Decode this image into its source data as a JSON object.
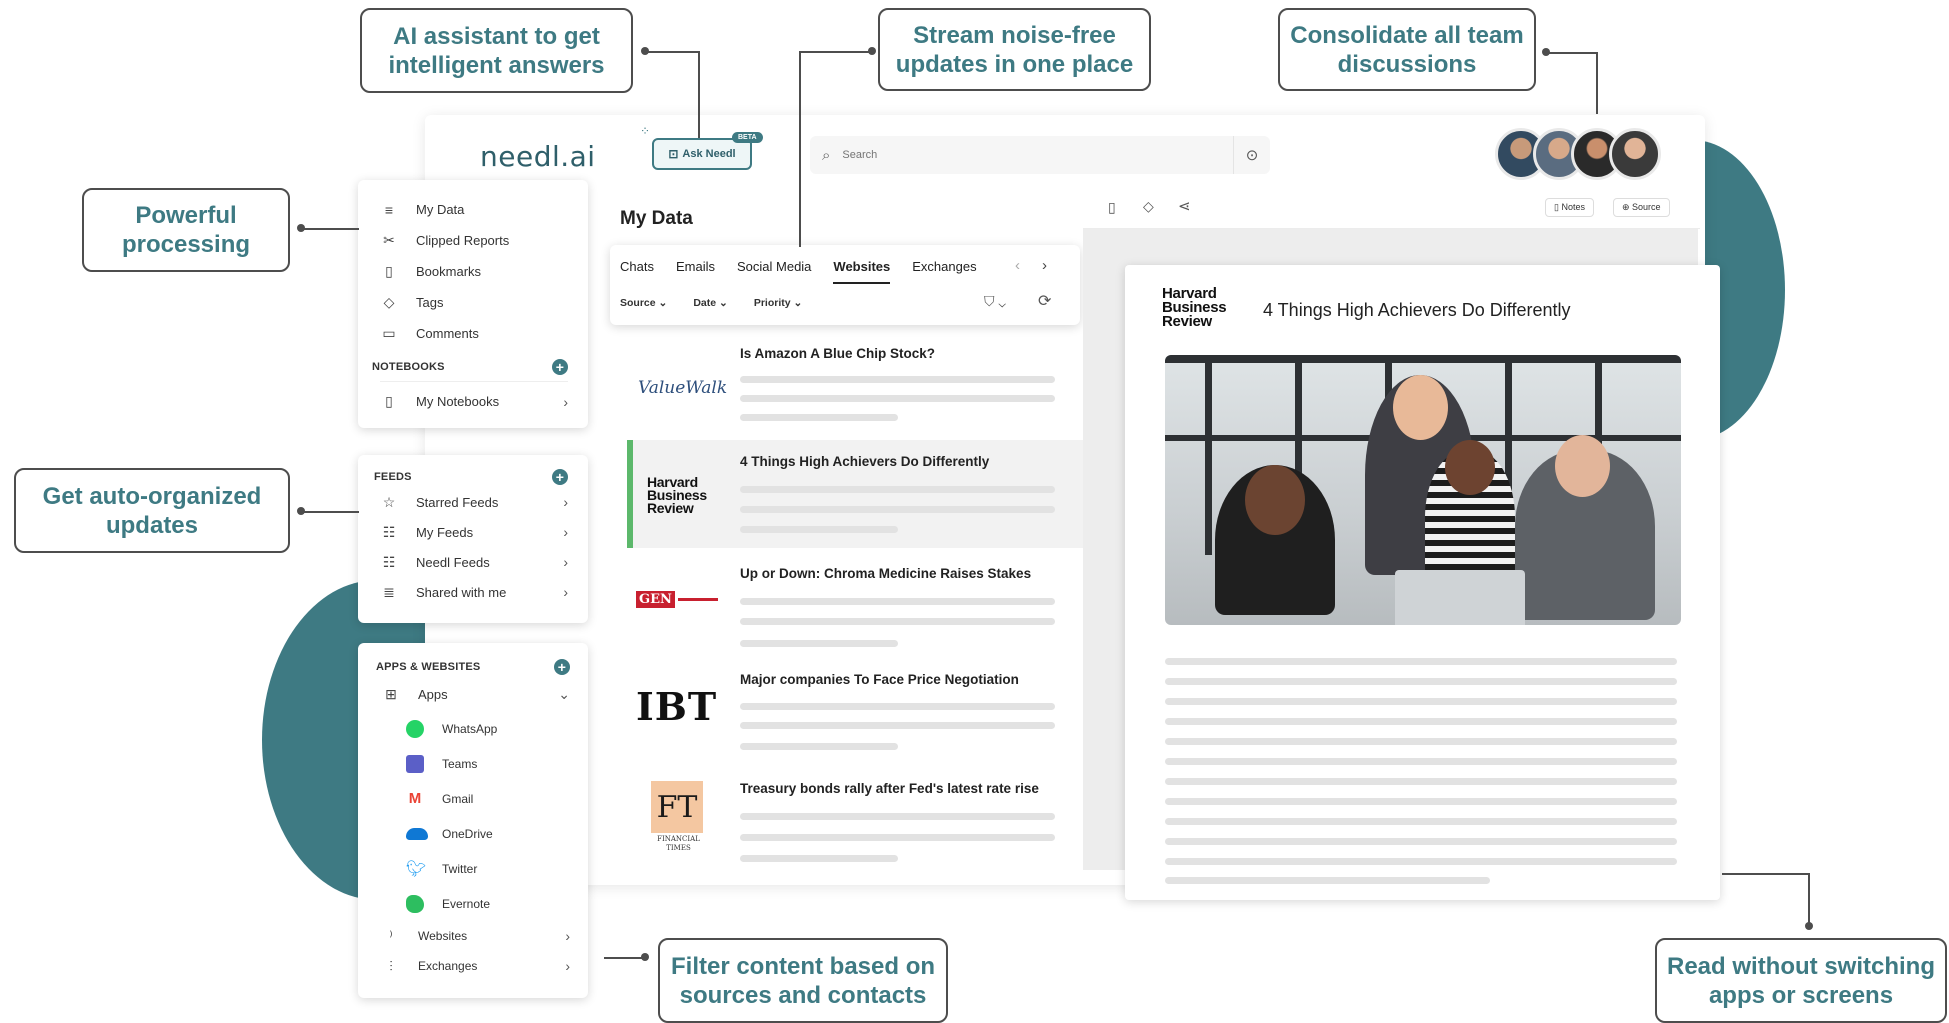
{
  "callouts": {
    "ai": "AI assistant to get intelligent answers",
    "stream": "Stream noise-free updates in one place",
    "consolidate": "Consolidate all team discussions",
    "processing": "Powerful processing",
    "organized": "Get auto-organized updates",
    "filter": "Filter content based on sources and contacts",
    "read": "Read without switching apps or screens"
  },
  "header": {
    "logo": "needl.ai",
    "ask_button": "Ask Needl",
    "beta": "BETA",
    "search_placeholder": "Search"
  },
  "sidebar": {
    "items": [
      {
        "label": "My Data",
        "icon": "list-icon"
      },
      {
        "label": "Clipped Reports",
        "icon": "scissors-icon"
      },
      {
        "label": "Bookmarks",
        "icon": "bookmark-icon"
      },
      {
        "label": "Tags",
        "icon": "tag-icon"
      },
      {
        "label": "Comments",
        "icon": "comment-icon"
      }
    ],
    "notebooks_heading": "NOTEBOOKS",
    "my_notebooks": "My Notebooks",
    "feeds_heading": "FEEDS",
    "feeds": [
      {
        "label": "Starred Feeds",
        "icon": "star-icon"
      },
      {
        "label": "My Feeds",
        "icon": "feed-icon"
      },
      {
        "label": "Needl Feeds",
        "icon": "feed-icon"
      },
      {
        "label": "Shared with me",
        "icon": "menu-icon"
      }
    ],
    "apps_heading": "APPS & WEBSITES",
    "apps_label": "Apps",
    "apps": [
      {
        "label": "WhatsApp",
        "color": "#25d366"
      },
      {
        "label": "Teams",
        "color": "#5b5fc7"
      },
      {
        "label": "Gmail",
        "color": "#ea4335"
      },
      {
        "label": "OneDrive",
        "color": "#0f78d4"
      },
      {
        "label": "Twitter",
        "color": "#1d9bf0"
      },
      {
        "label": "Evernote",
        "color": "#2dbe60"
      }
    ],
    "websites": "Websites",
    "exchanges": "Exchanges"
  },
  "main": {
    "title": "My Data",
    "tabs": [
      "Chats",
      "Emails",
      "Social Media",
      "Websites",
      "Exchanges"
    ],
    "active_tab": "Websites",
    "filters": [
      "Source",
      "Date",
      "Priority"
    ],
    "items": [
      {
        "source": "ValueWalk",
        "title": "Is Amazon A Blue Chip Stock?"
      },
      {
        "source": "Harvard Business Review",
        "title": "4 Things High Achievers Do Differently"
      },
      {
        "source": "GEN",
        "title": "Up or Down: Chroma Medicine Raises Stakes"
      },
      {
        "source": "IBT",
        "title": "Major companies To Face Price Negotiation"
      },
      {
        "source": "FT",
        "title": "Treasury bonds rally after Fed's latest rate rise"
      }
    ],
    "ft_caption": "FINANCIAL TIMES"
  },
  "reader": {
    "notes": "Notes",
    "source": "Source",
    "publisher": "Harvard Business Review",
    "title": "4 Things High Achievers Do Differently"
  },
  "colors": {
    "accent": "#3e7a83",
    "highlight": "#5cb86b"
  }
}
